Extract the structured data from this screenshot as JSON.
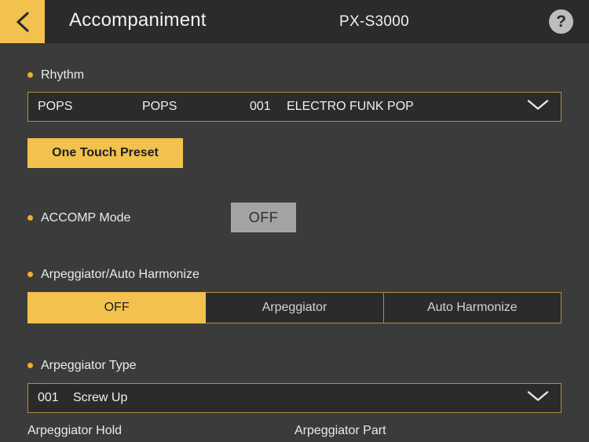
{
  "header": {
    "back_icon": "chevron-left-icon",
    "title": "Accompaniment",
    "model": "PX-S3000",
    "help_icon": "question-mark-icon",
    "help_label": "?"
  },
  "colors": {
    "accent": "#f2c14e",
    "bullet": "#f0ad2e",
    "border": "#b08f3c",
    "background": "#3b3b3b",
    "header_background": "#2b2b2b",
    "field_background": "#2b2b2b",
    "toggle_off": "#a3a3a3"
  },
  "sections": {
    "rhythm": {
      "label": "Rhythm",
      "dropdown": {
        "category": "POPS",
        "subcategory": "POPS",
        "number": "001",
        "name": "ELECTRO FUNK POP",
        "chevron_icon": "chevron-down-icon"
      },
      "one_touch_preset_label": "One Touch Preset"
    },
    "accomp_mode": {
      "label": "ACCOMP Mode",
      "value": "OFF"
    },
    "arpeggiator_harmonize": {
      "label": "Arpeggiator/Auto Harmonize",
      "options": [
        {
          "label": "OFF",
          "selected": true
        },
        {
          "label": "Arpeggiator",
          "selected": false
        },
        {
          "label": "Auto Harmonize",
          "selected": false
        }
      ]
    },
    "arpeggiator_type": {
      "label": "Arpeggiator Type",
      "dropdown": {
        "number": "001",
        "name": "Screw Up",
        "chevron_icon": "chevron-down-icon"
      }
    },
    "arpeggiator_hold": {
      "label": "Arpeggiator Hold"
    },
    "arpeggiator_part": {
      "label": "Arpeggiator Part"
    }
  },
  "scrollbar": {
    "name": "vertical-scrollbar"
  }
}
